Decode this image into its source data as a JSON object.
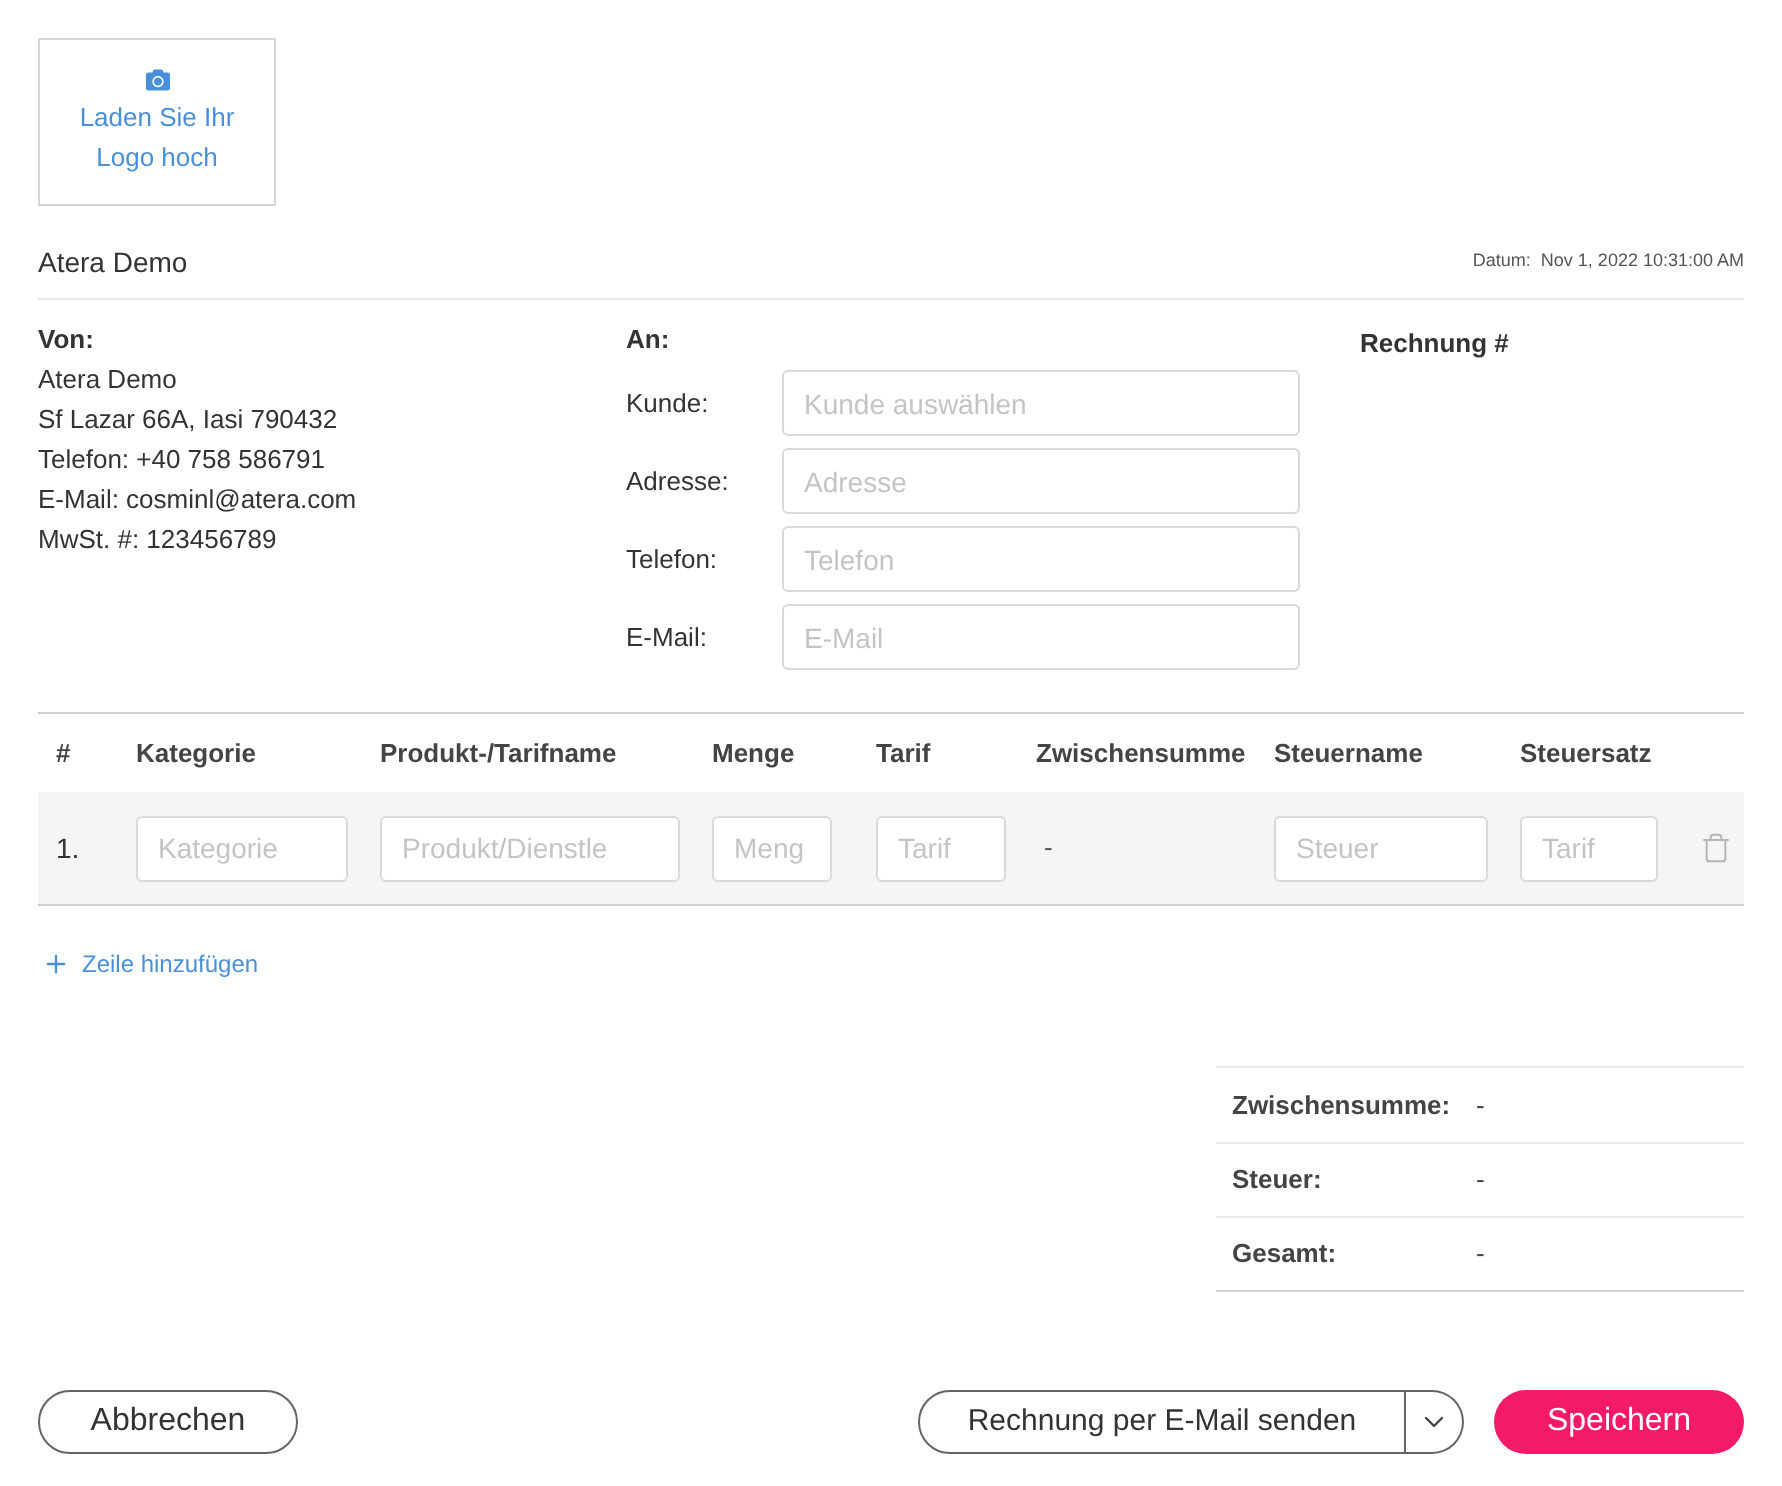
{
  "logo_upload": {
    "label": "Laden Sie Ihr Logo hoch"
  },
  "company_name": "Atera Demo",
  "date": {
    "label": "Datum:",
    "value": "Nov 1, 2022 10:31:00 AM"
  },
  "from": {
    "heading": "Von:",
    "lines": [
      "Atera Demo",
      "Sf Lazar 66A, Iasi 790432",
      "Telefon: +40 758 586791",
      "E-Mail: cosminl@atera.com",
      "MwSt. #: 123456789"
    ]
  },
  "to": {
    "heading": "An:",
    "fields": [
      {
        "label": "Kunde:",
        "placeholder": "Kunde auswählen"
      },
      {
        "label": "Adresse:",
        "placeholder": "Adresse"
      },
      {
        "label": "Telefon:",
        "placeholder": "Telefon"
      },
      {
        "label": "E-Mail:",
        "placeholder": "E-Mail"
      }
    ]
  },
  "invoice_number": {
    "label": "Rechnung #"
  },
  "line_items": {
    "columns": [
      "#",
      "Kategorie",
      "Produkt-/Tarifname",
      "Menge",
      "Tarif",
      "Zwischensumme",
      "Steuername",
      "Steuersatz"
    ],
    "rows": [
      {
        "cells": [
          {
            "kind": "number",
            "value": "1."
          },
          {
            "kind": "input",
            "placeholder": "Kategorie"
          },
          {
            "kind": "input",
            "placeholder": "Produkt/Dienstle"
          },
          {
            "kind": "input",
            "placeholder": "Meng"
          },
          {
            "kind": "input",
            "placeholder": "Tarif"
          },
          {
            "kind": "text",
            "value": "-"
          },
          {
            "kind": "input",
            "placeholder": "Steuer"
          },
          {
            "kind": "input",
            "placeholder": "Tarif"
          }
        ]
      }
    ]
  },
  "add_row": {
    "label": "Zeile hinzufügen"
  },
  "totals": [
    {
      "label": "Zwischensumme:",
      "value": "-"
    },
    {
      "label": "Steuer:",
      "value": "-"
    },
    {
      "label": "Gesamt:",
      "value": "-"
    }
  ],
  "buttons": {
    "cancel": "Abbrechen",
    "send_email": "Rechnung per E-Mail senden",
    "save": "Speichern"
  }
}
